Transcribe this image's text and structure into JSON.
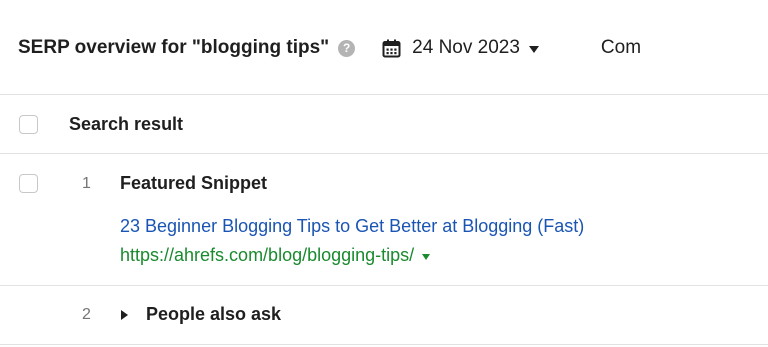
{
  "header": {
    "title": "SERP overview for \"blogging tips\"",
    "help_icon": "question-circle-icon",
    "help_glyph": "?",
    "date": "24 Nov 2023",
    "date_icon": "calendar-icon",
    "compare_label": "Com"
  },
  "table": {
    "column_header": "Search result",
    "rows": [
      {
        "position": "1",
        "title": "Featured Snippet",
        "link_text": "23 Beginner Blogging Tips to Get Better at Blogging (Fast)",
        "url": "https://ahrefs.com/blog/blogging-tips/"
      },
      {
        "position": "2",
        "title": "People also ask"
      }
    ]
  },
  "colors": {
    "link": "#1a55b3",
    "url": "#1a8a2e",
    "divider": "#e2e2e2"
  }
}
